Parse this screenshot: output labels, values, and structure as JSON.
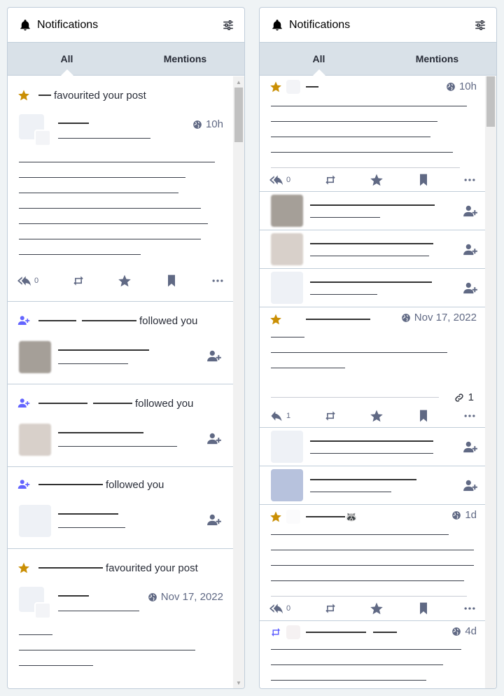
{
  "colors": {
    "accent": "#6364ff",
    "star": "#ca8f04",
    "text": "#282c37",
    "muted": "#606984"
  },
  "columns": [
    {
      "title": "Notifications",
      "tabs": [
        "All",
        "Mentions"
      ],
      "items": [
        {
          "kind": "favourite",
          "action": "favourited your post",
          "time": "10h",
          "replies": "0"
        },
        {
          "kind": "follow",
          "action": "followed you"
        },
        {
          "kind": "follow",
          "action": "followed you"
        },
        {
          "kind": "follow",
          "action": "followed you"
        },
        {
          "kind": "favourite",
          "action": "favourited your post",
          "time": "Nov 17, 2022"
        }
      ]
    },
    {
      "title": "Notifications",
      "tabs": [
        "All",
        "Mentions"
      ],
      "items": [
        {
          "kind": "favourite",
          "time": "10h",
          "replies": "0"
        },
        {
          "kind": "follow-row"
        },
        {
          "kind": "follow-row"
        },
        {
          "kind": "follow-row"
        },
        {
          "kind": "favourite",
          "time": "Nov 17, 2022",
          "replies": "1",
          "links": "1"
        },
        {
          "kind": "follow-row"
        },
        {
          "kind": "follow-row"
        },
        {
          "kind": "favourite",
          "time": "1d",
          "replies": "0",
          "emoji": "🦝"
        },
        {
          "kind": "boost",
          "time": "4d"
        }
      ]
    }
  ]
}
